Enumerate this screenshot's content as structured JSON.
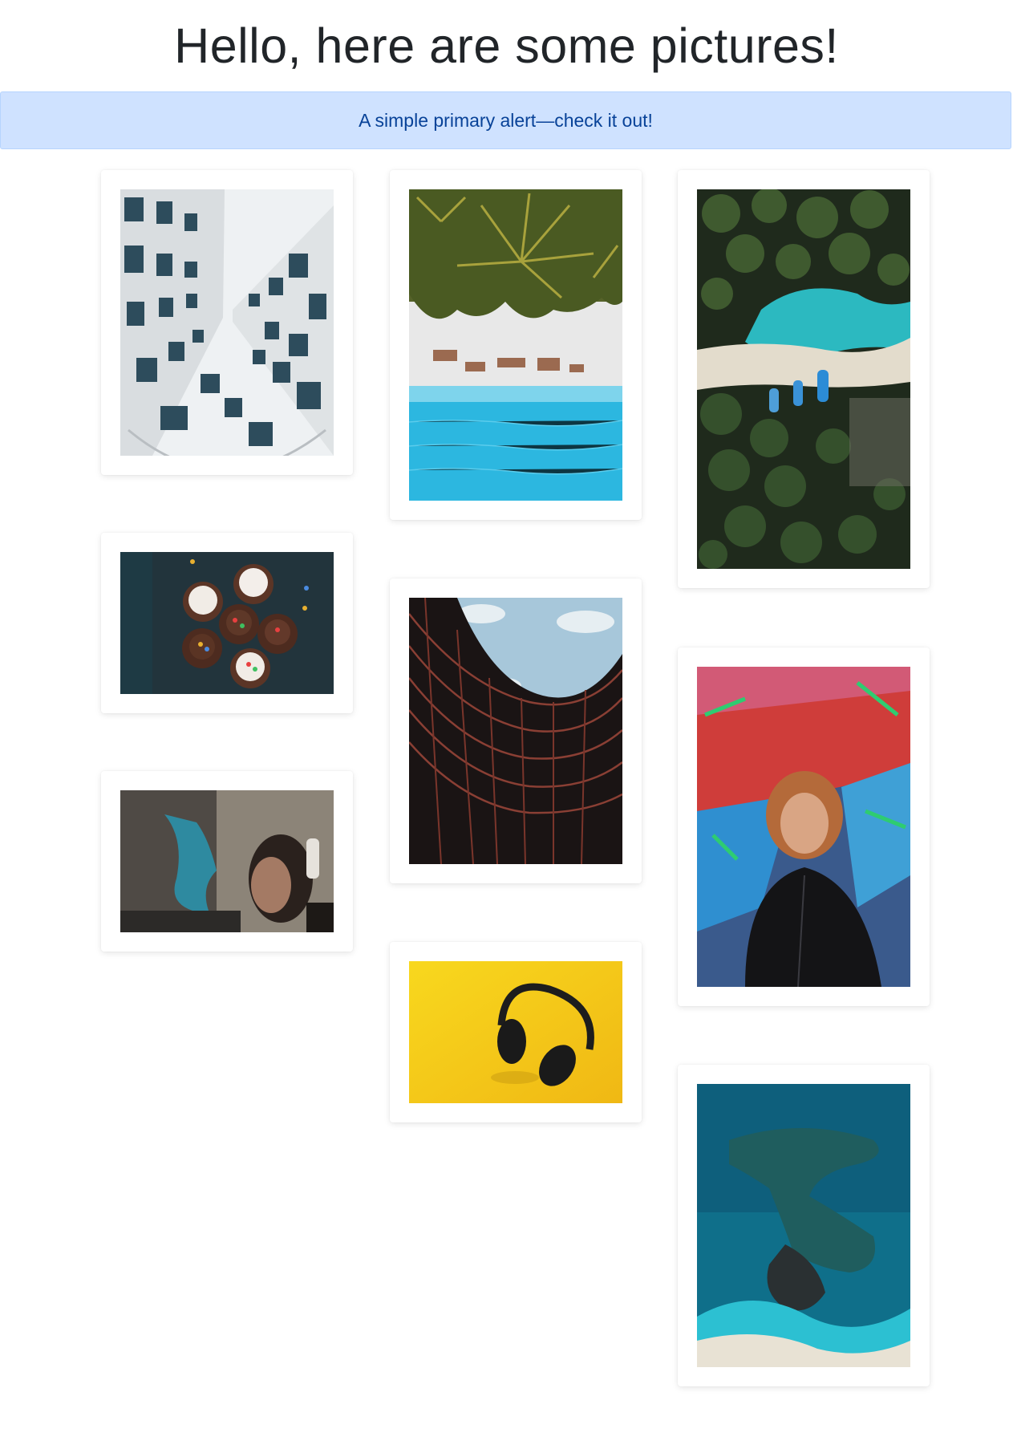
{
  "page": {
    "title": "Hello, here are some pictures!"
  },
  "alert": {
    "text": "A simple primary alert—check it out!",
    "background": "#cfe2ff",
    "text_color": "#084298"
  },
  "gallery": {
    "columns": [
      {
        "cards": [
          {
            "subject": "building-looking-up",
            "orientation": "portrait"
          },
          {
            "subject": "cupcakes",
            "orientation": "landscape"
          },
          {
            "subject": "graffiti-girl-headphones",
            "orientation": "landscape"
          }
        ]
      },
      {
        "cards": [
          {
            "subject": "beach-palms-aerial",
            "orientation": "portrait"
          },
          {
            "subject": "curved-building",
            "orientation": "portrait"
          },
          {
            "subject": "headphones-yellow",
            "orientation": "landscape"
          }
        ]
      },
      {
        "cards": [
          {
            "subject": "palms-boats-aerial",
            "orientation": "portrait"
          },
          {
            "subject": "boy-graffiti-wall",
            "orientation": "portrait"
          },
          {
            "subject": "ocean-island-aerial",
            "orientation": "portrait"
          }
        ]
      }
    ]
  }
}
